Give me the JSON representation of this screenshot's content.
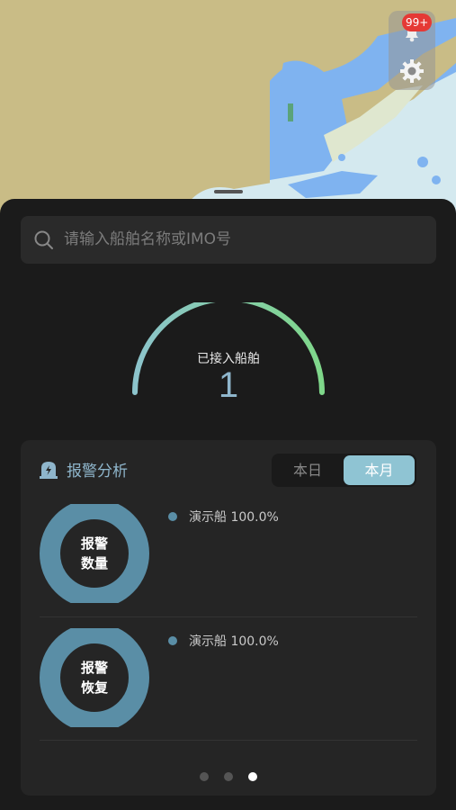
{
  "header": {
    "notification_badge": "99+",
    "bell_icon": "bell-icon",
    "settings_icon": "gear-icon"
  },
  "search": {
    "placeholder": "请输入船舶名称或IMO号"
  },
  "gauge": {
    "label": "已接入船舶",
    "value": "1"
  },
  "alarm": {
    "title": "报警分析",
    "tabs": [
      {
        "label": "本日",
        "active": false
      },
      {
        "label": "本月",
        "active": true
      }
    ],
    "charts": [
      {
        "center_line1": "报警",
        "center_line2": "数量",
        "legend": "演示船 100.0%",
        "share": 100.0
      },
      {
        "center_line1": "报警",
        "center_line2": "恢复",
        "legend": "演示船 100.0%",
        "share": 100.0
      }
    ]
  },
  "pager": {
    "count": 3,
    "active_index": 2
  },
  "colors": {
    "accent": "#8fb6cc",
    "ring": "#5a8ea6",
    "tab_active": "#8fc4d3",
    "badge": "#e53935",
    "gauge_start": "#8cc4cc",
    "gauge_end": "#7fd78a"
  }
}
